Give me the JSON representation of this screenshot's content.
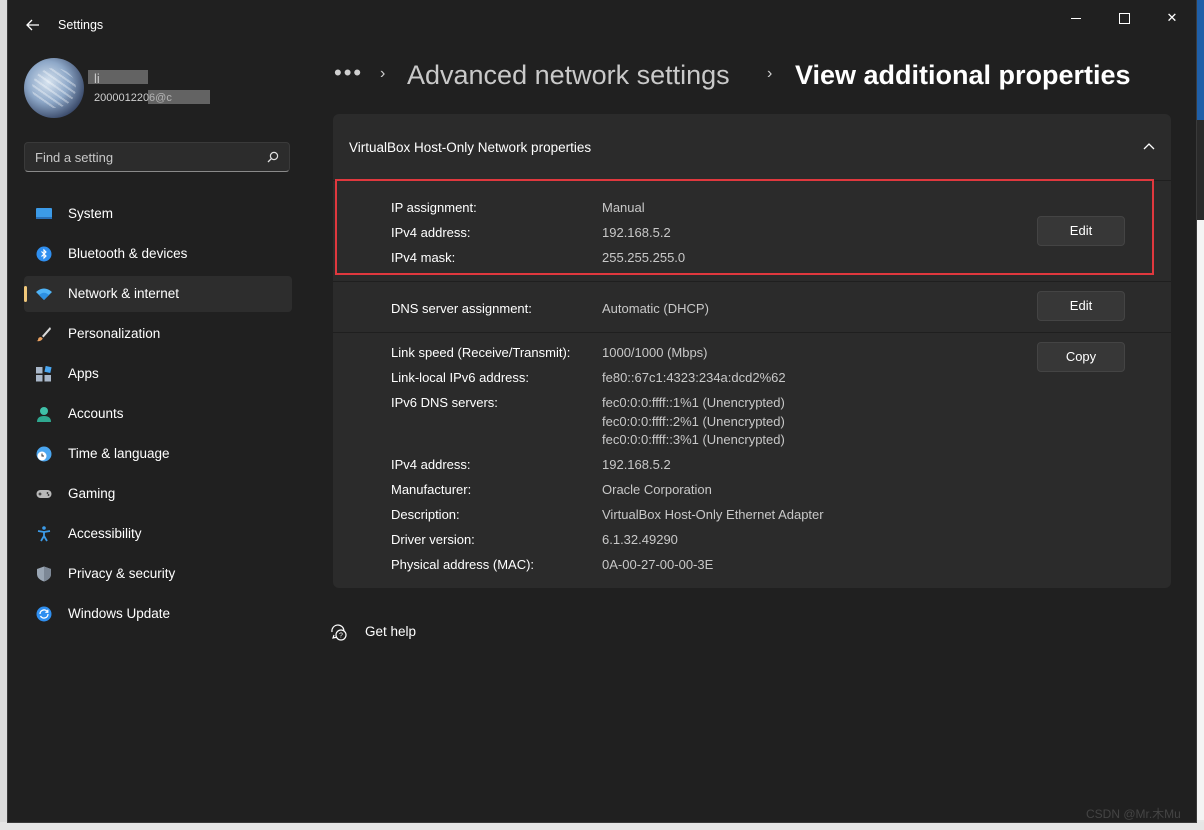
{
  "window": {
    "app_title": "Settings",
    "controls": {
      "minimize": "minimize",
      "maximize": "maximize",
      "close": "✕"
    }
  },
  "user": {
    "name_visible": "li",
    "email_visible": "2000012206@c"
  },
  "search": {
    "placeholder": "Find a setting"
  },
  "sidebar": {
    "items": [
      {
        "label": "System",
        "icon": "monitor-icon",
        "color": "#3c9be8"
      },
      {
        "label": "Bluetooth & devices",
        "icon": "bluetooth-icon",
        "color": "#2f8ff0"
      },
      {
        "label": "Network & internet",
        "icon": "wifi-icon",
        "color": "#4fb3f6",
        "active": true
      },
      {
        "label": "Personalization",
        "icon": "brush-icon",
        "color": "#e8a060"
      },
      {
        "label": "Apps",
        "icon": "apps-icon",
        "color": "#a9b7c9"
      },
      {
        "label": "Accounts",
        "icon": "person-icon",
        "color": "#3fc0a8"
      },
      {
        "label": "Time & language",
        "icon": "globe-clock-icon",
        "color": "#4aa6f0"
      },
      {
        "label": "Gaming",
        "icon": "gamepad-icon",
        "color": "#b9b9b9"
      },
      {
        "label": "Accessibility",
        "icon": "accessibility-icon",
        "color": "#3c9be8"
      },
      {
        "label": "Privacy & security",
        "icon": "shield-icon",
        "color": "#9aa6b4"
      },
      {
        "label": "Windows Update",
        "icon": "update-icon",
        "color": "#2f8ff0"
      }
    ]
  },
  "breadcrumb": {
    "overflow": "•••",
    "separator": "›",
    "parent": "Advanced network settings",
    "current": "View additional properties"
  },
  "card": {
    "title": "VirtualBox Host-Only Network properties",
    "ip_section": {
      "rows": [
        {
          "label": "IP assignment:",
          "value": "Manual"
        },
        {
          "label": "IPv4 address:",
          "value": "192.168.5.2"
        },
        {
          "label": "IPv4 mask:",
          "value": "255.255.255.0"
        }
      ],
      "button": "Edit"
    },
    "dns_section": {
      "label": "DNS server assignment:",
      "value": "Automatic (DHCP)",
      "button": "Edit"
    },
    "details_section": {
      "button": "Copy",
      "rows": [
        {
          "label": "Link speed (Receive/Transmit):",
          "value": "1000/1000 (Mbps)"
        },
        {
          "label": "Link-local IPv6 address:",
          "value": "fe80::67c1:4323:234a:dcd2%62"
        },
        {
          "label": "IPv6 DNS servers:",
          "value": "fec0:0:0:ffff::1%1 (Unencrypted)",
          "value2": "fec0:0:0:ffff::2%1 (Unencrypted)",
          "value3": "fec0:0:0:ffff::3%1 (Unencrypted)"
        },
        {
          "label": "IPv4 address:",
          "value": "192.168.5.2"
        },
        {
          "label": "Manufacturer:",
          "value": "Oracle Corporation"
        },
        {
          "label": "Description:",
          "value": "VirtualBox Host-Only Ethernet Adapter"
        },
        {
          "label": "Driver version:",
          "value": "6.1.32.49290"
        },
        {
          "label": "Physical address (MAC):",
          "value": "0A-00-27-00-00-3E"
        }
      ]
    }
  },
  "help": {
    "label": "Get help"
  },
  "watermark": "CSDN @Mr.木Mu",
  "colors": {
    "window_bg": "#202020",
    "card_bg": "#2b2b2b",
    "highlight_border": "#e0383e",
    "active_indicator": "#f0c77a"
  }
}
